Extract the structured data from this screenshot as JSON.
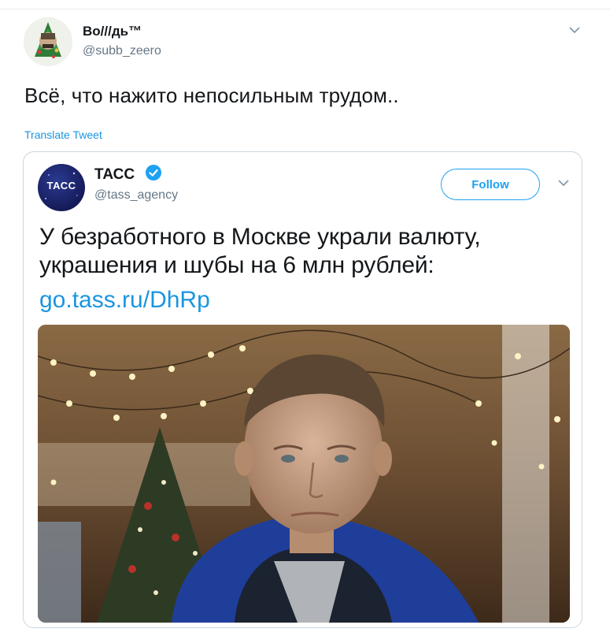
{
  "tweet": {
    "author_name": "Во///дь™",
    "author_handle": "@subb_zeero",
    "text": "Всё, что нажито непосильным трудом..",
    "translate_label": "Translate Tweet"
  },
  "quoted": {
    "author_name": "ТАСС",
    "author_handle": "@tass_agency",
    "avatar_text": "ТАСС",
    "follow_label": "Follow",
    "text": "У безработного в Москве украли валюту, украшения и шубы на 6 млн рублей:",
    "link": "go.tass.ru/DhRp"
  },
  "icons": {
    "more": "chevron-down-icon",
    "verified": "verified-badge-icon"
  },
  "colors": {
    "link": "#1b95e0",
    "follow": "#1da1f2",
    "tass_avatar": "#151c5a"
  }
}
